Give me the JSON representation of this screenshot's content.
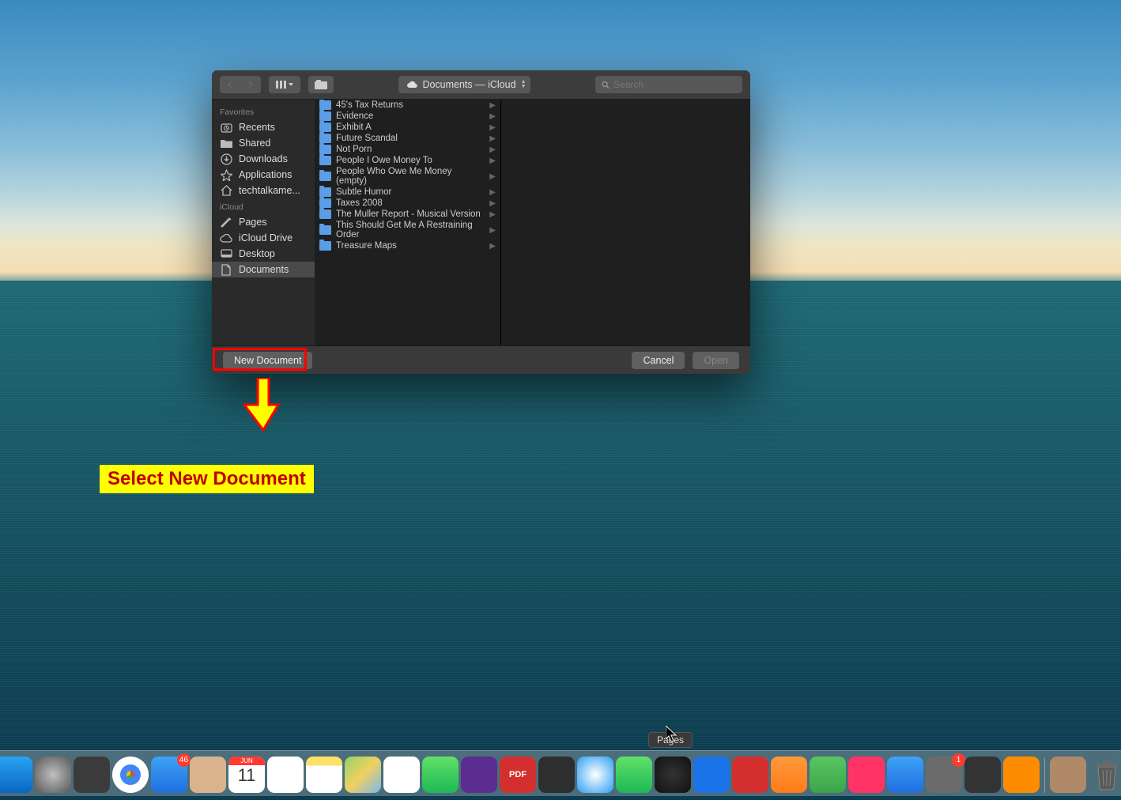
{
  "titlebar": {
    "location_label": "Documents — iCloud",
    "search_placeholder": "Search"
  },
  "sidebar": {
    "sections": [
      {
        "header": "Favorites",
        "items": [
          {
            "label": "Recents",
            "icon": "clock-icon"
          },
          {
            "label": "Shared",
            "icon": "folder-icon"
          },
          {
            "label": "Downloads",
            "icon": "download-icon"
          },
          {
            "label": "Applications",
            "icon": "applications-icon"
          },
          {
            "label": "techtalkame...",
            "icon": "home-icon"
          }
        ]
      },
      {
        "header": "iCloud",
        "items": [
          {
            "label": "Pages",
            "icon": "pages-icon"
          },
          {
            "label": "iCloud Drive",
            "icon": "cloud-icon"
          },
          {
            "label": "Desktop",
            "icon": "desktop-icon"
          },
          {
            "label": "Documents",
            "icon": "document-icon",
            "selected": true
          }
        ]
      }
    ]
  },
  "files": [
    {
      "name": "45's Tax Returns"
    },
    {
      "name": "Evidence"
    },
    {
      "name": "Exhibit A"
    },
    {
      "name": "Future Scandal"
    },
    {
      "name": "Not Porn"
    },
    {
      "name": "People I Owe Money To"
    },
    {
      "name": "People Who Owe Me Money (empty)"
    },
    {
      "name": "Subtle Humor"
    },
    {
      "name": "Taxes 2008"
    },
    {
      "name": "The Muller Report - Musical Version"
    },
    {
      "name": "This Should Get Me A Restraining Order"
    },
    {
      "name": "Treasure Maps"
    }
  ],
  "footer": {
    "new_document": "New Document",
    "cancel": "Cancel",
    "open": "Open"
  },
  "annotation": {
    "text": "Select New Document"
  },
  "dock": {
    "tooltip": "Pages",
    "items": [
      {
        "name": "finder",
        "bg": "linear-gradient(#2aa3f3,#0a66c2)"
      },
      {
        "name": "launchpad",
        "bg": "radial-gradient(circle,#c0c0c0,#555)"
      },
      {
        "name": "mission-control",
        "bg": "#3b3b3b"
      },
      {
        "name": "chrome",
        "bg": "conic-gradient(#ea4335 0 120deg,#34a853 120deg 240deg,#fbbc05 240deg 360deg)"
      },
      {
        "name": "mail",
        "bg": "linear-gradient(#3fa2f7,#1e6fe0)",
        "badge": "46"
      },
      {
        "name": "contacts",
        "bg": "#d9b38c"
      },
      {
        "name": "calendar",
        "bg": "#fff",
        "text": "11",
        "head": "JUN"
      },
      {
        "name": "reminders",
        "bg": "#fff"
      },
      {
        "name": "notes",
        "bg": "linear-gradient(#ffe066 0 25%,#fff 25%)"
      },
      {
        "name": "maps",
        "bg": "linear-gradient(135deg,#8fd36a,#f0d060,#7ab8f0)"
      },
      {
        "name": "photos",
        "bg": "#fff"
      },
      {
        "name": "facetime",
        "bg": "linear-gradient(#62e06a,#1db954)"
      },
      {
        "name": "imovie",
        "bg": "#5b2d91"
      },
      {
        "name": "pdf",
        "bg": "#d32f2f",
        "text": "PDF"
      },
      {
        "name": "clips",
        "bg": "#2e2e2e"
      },
      {
        "name": "safari",
        "bg": "radial-gradient(circle,#fff,#2a9df4)"
      },
      {
        "name": "messages",
        "bg": "linear-gradient(#62e06a,#1db954)"
      },
      {
        "name": "dashboard",
        "bg": "radial-gradient(circle,#333,#111)"
      },
      {
        "name": "malwarebytes",
        "bg": "#1a73e8"
      },
      {
        "name": "1password",
        "bg": "#d32f2f"
      },
      {
        "name": "pages",
        "bg": "linear-gradient(#ff9a3c,#ff7a18)"
      },
      {
        "name": "numbers",
        "bg": "linear-gradient(#5ac562,#3aa64a)"
      },
      {
        "name": "news",
        "bg": "#ff3366"
      },
      {
        "name": "appstore",
        "bg": "linear-gradient(#3fa2f7,#1e6fe0)"
      },
      {
        "name": "settings",
        "bg": "#6b6b6b",
        "badge": "1"
      },
      {
        "name": "quicktime",
        "bg": "#333"
      },
      {
        "name": "vlc",
        "bg": "#ff8c00"
      },
      {
        "name": "sep"
      },
      {
        "name": "downloads-stack",
        "bg": "#b08968"
      },
      {
        "name": "trash",
        "bg": "transparent"
      }
    ]
  }
}
